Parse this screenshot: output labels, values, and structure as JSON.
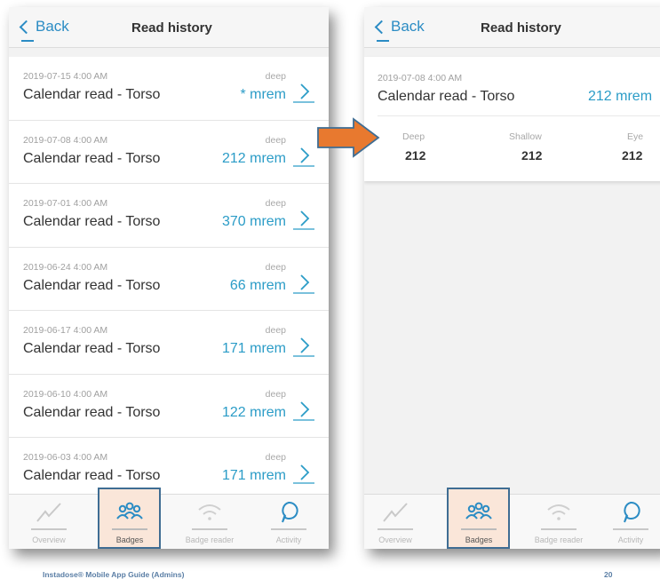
{
  "left": {
    "nav": {
      "back_label": "Back",
      "title": "Read history"
    },
    "rows": [
      {
        "date": "2019-07-15 4:00 AM",
        "name": "Calendar read - Torso",
        "kind": "deep",
        "value": "* mrem"
      },
      {
        "date": "2019-07-08 4:00 AM",
        "name": "Calendar read - Torso",
        "kind": "deep",
        "value": "212 mrem"
      },
      {
        "date": "2019-07-01 4:00 AM",
        "name": "Calendar read - Torso",
        "kind": "deep",
        "value": "370 mrem"
      },
      {
        "date": "2019-06-24 4:00 AM",
        "name": "Calendar read - Torso",
        "kind": "deep",
        "value": "66 mrem"
      },
      {
        "date": "2019-06-17 4:00 AM",
        "name": "Calendar read - Torso",
        "kind": "deep",
        "value": "171 mrem"
      },
      {
        "date": "2019-06-10 4:00 AM",
        "name": "Calendar read - Torso",
        "kind": "deep",
        "value": "122 mrem"
      },
      {
        "date": "2019-06-03 4:00 AM",
        "name": "Calendar read - Torso",
        "kind": "deep",
        "value": "171 mrem"
      }
    ]
  },
  "right": {
    "nav": {
      "back_label": "Back",
      "title": "Read history"
    },
    "detail": {
      "date": "2019-07-08 4:00 AM",
      "name": "Calendar read - Torso",
      "value": "212 mrem",
      "columns": [
        {
          "label": "Deep",
          "value": "212"
        },
        {
          "label": "Shallow",
          "value": "212"
        },
        {
          "label": "Eye",
          "value": "212"
        }
      ]
    }
  },
  "tabs": [
    {
      "label": "Overview",
      "icon": "chart-line-icon"
    },
    {
      "label": "Badges",
      "icon": "users-group-icon"
    },
    {
      "label": "Badge reader",
      "icon": "wifi-icon"
    },
    {
      "label": "Activity",
      "icon": "speech-bubble-icon"
    }
  ],
  "active_tab": "Badges",
  "footer": {
    "guide": "Instadose® Mobile App Guide (Admins)",
    "page": "20"
  },
  "colors": {
    "accent": "#2b9cc7",
    "highlight_border": "#3f6d93",
    "highlight_fill": "#fae6d9",
    "arrow": "#e8792f"
  }
}
